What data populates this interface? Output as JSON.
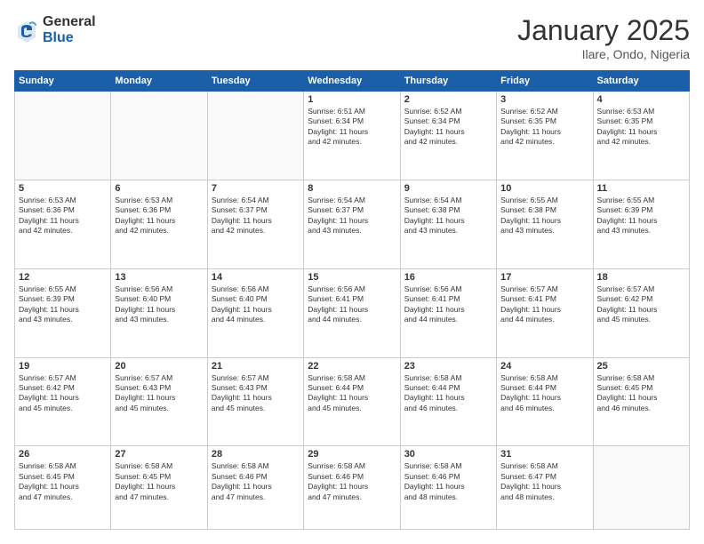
{
  "header": {
    "logo_general": "General",
    "logo_blue": "Blue",
    "month_title": "January 2025",
    "location": "Ilare, Ondo, Nigeria"
  },
  "columns": [
    "Sunday",
    "Monday",
    "Tuesday",
    "Wednesday",
    "Thursday",
    "Friday",
    "Saturday"
  ],
  "weeks": [
    [
      {
        "day": "",
        "info": ""
      },
      {
        "day": "",
        "info": ""
      },
      {
        "day": "",
        "info": ""
      },
      {
        "day": "1",
        "info": "Sunrise: 6:51 AM\nSunset: 6:34 PM\nDaylight: 11 hours\nand 42 minutes."
      },
      {
        "day": "2",
        "info": "Sunrise: 6:52 AM\nSunset: 6:34 PM\nDaylight: 11 hours\nand 42 minutes."
      },
      {
        "day": "3",
        "info": "Sunrise: 6:52 AM\nSunset: 6:35 PM\nDaylight: 11 hours\nand 42 minutes."
      },
      {
        "day": "4",
        "info": "Sunrise: 6:53 AM\nSunset: 6:35 PM\nDaylight: 11 hours\nand 42 minutes."
      }
    ],
    [
      {
        "day": "5",
        "info": "Sunrise: 6:53 AM\nSunset: 6:36 PM\nDaylight: 11 hours\nand 42 minutes."
      },
      {
        "day": "6",
        "info": "Sunrise: 6:53 AM\nSunset: 6:36 PM\nDaylight: 11 hours\nand 42 minutes."
      },
      {
        "day": "7",
        "info": "Sunrise: 6:54 AM\nSunset: 6:37 PM\nDaylight: 11 hours\nand 42 minutes."
      },
      {
        "day": "8",
        "info": "Sunrise: 6:54 AM\nSunset: 6:37 PM\nDaylight: 11 hours\nand 43 minutes."
      },
      {
        "day": "9",
        "info": "Sunrise: 6:54 AM\nSunset: 6:38 PM\nDaylight: 11 hours\nand 43 minutes."
      },
      {
        "day": "10",
        "info": "Sunrise: 6:55 AM\nSunset: 6:38 PM\nDaylight: 11 hours\nand 43 minutes."
      },
      {
        "day": "11",
        "info": "Sunrise: 6:55 AM\nSunset: 6:39 PM\nDaylight: 11 hours\nand 43 minutes."
      }
    ],
    [
      {
        "day": "12",
        "info": "Sunrise: 6:55 AM\nSunset: 6:39 PM\nDaylight: 11 hours\nand 43 minutes."
      },
      {
        "day": "13",
        "info": "Sunrise: 6:56 AM\nSunset: 6:40 PM\nDaylight: 11 hours\nand 43 minutes."
      },
      {
        "day": "14",
        "info": "Sunrise: 6:56 AM\nSunset: 6:40 PM\nDaylight: 11 hours\nand 44 minutes."
      },
      {
        "day": "15",
        "info": "Sunrise: 6:56 AM\nSunset: 6:41 PM\nDaylight: 11 hours\nand 44 minutes."
      },
      {
        "day": "16",
        "info": "Sunrise: 6:56 AM\nSunset: 6:41 PM\nDaylight: 11 hours\nand 44 minutes."
      },
      {
        "day": "17",
        "info": "Sunrise: 6:57 AM\nSunset: 6:41 PM\nDaylight: 11 hours\nand 44 minutes."
      },
      {
        "day": "18",
        "info": "Sunrise: 6:57 AM\nSunset: 6:42 PM\nDaylight: 11 hours\nand 45 minutes."
      }
    ],
    [
      {
        "day": "19",
        "info": "Sunrise: 6:57 AM\nSunset: 6:42 PM\nDaylight: 11 hours\nand 45 minutes."
      },
      {
        "day": "20",
        "info": "Sunrise: 6:57 AM\nSunset: 6:43 PM\nDaylight: 11 hours\nand 45 minutes."
      },
      {
        "day": "21",
        "info": "Sunrise: 6:57 AM\nSunset: 6:43 PM\nDaylight: 11 hours\nand 45 minutes."
      },
      {
        "day": "22",
        "info": "Sunrise: 6:58 AM\nSunset: 6:44 PM\nDaylight: 11 hours\nand 45 minutes."
      },
      {
        "day": "23",
        "info": "Sunrise: 6:58 AM\nSunset: 6:44 PM\nDaylight: 11 hours\nand 46 minutes."
      },
      {
        "day": "24",
        "info": "Sunrise: 6:58 AM\nSunset: 6:44 PM\nDaylight: 11 hours\nand 46 minutes."
      },
      {
        "day": "25",
        "info": "Sunrise: 6:58 AM\nSunset: 6:45 PM\nDaylight: 11 hours\nand 46 minutes."
      }
    ],
    [
      {
        "day": "26",
        "info": "Sunrise: 6:58 AM\nSunset: 6:45 PM\nDaylight: 11 hours\nand 47 minutes."
      },
      {
        "day": "27",
        "info": "Sunrise: 6:58 AM\nSunset: 6:45 PM\nDaylight: 11 hours\nand 47 minutes."
      },
      {
        "day": "28",
        "info": "Sunrise: 6:58 AM\nSunset: 6:46 PM\nDaylight: 11 hours\nand 47 minutes."
      },
      {
        "day": "29",
        "info": "Sunrise: 6:58 AM\nSunset: 6:46 PM\nDaylight: 11 hours\nand 47 minutes."
      },
      {
        "day": "30",
        "info": "Sunrise: 6:58 AM\nSunset: 6:46 PM\nDaylight: 11 hours\nand 48 minutes."
      },
      {
        "day": "31",
        "info": "Sunrise: 6:58 AM\nSunset: 6:47 PM\nDaylight: 11 hours\nand 48 minutes."
      },
      {
        "day": "",
        "info": ""
      }
    ]
  ]
}
